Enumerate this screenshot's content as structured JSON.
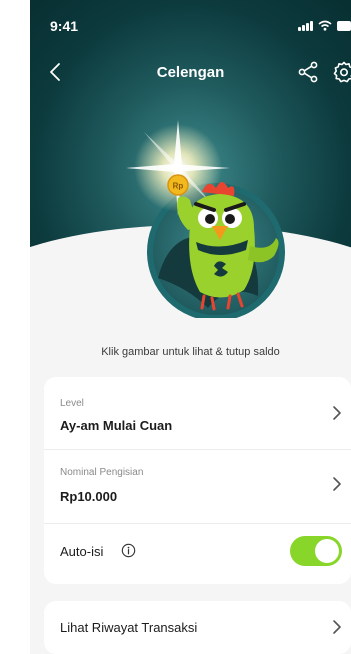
{
  "status_bar": {
    "time": "9:41"
  },
  "header": {
    "title": "Celengan"
  },
  "hint": "Klik gambar untuk lihat & tutup saldo",
  "settings": {
    "level": {
      "label": "Level",
      "value": "Ay-am Mulai Cuan"
    },
    "nominal": {
      "label": "Nominal Pengisian",
      "value": "Rp10.000"
    },
    "auto_fill": {
      "label": "Auto-isi",
      "enabled": true
    }
  },
  "history": {
    "label": "Lihat Riwayat Transaksi"
  },
  "mascot": {
    "coin_text": "Rp"
  },
  "colors": {
    "accent_green": "#88d62a",
    "header_teal": "#0c3a3d"
  },
  "icons": [
    "back-arrow-icon",
    "share-icon",
    "gear-icon",
    "info-icon",
    "chevron-right-icon"
  ]
}
